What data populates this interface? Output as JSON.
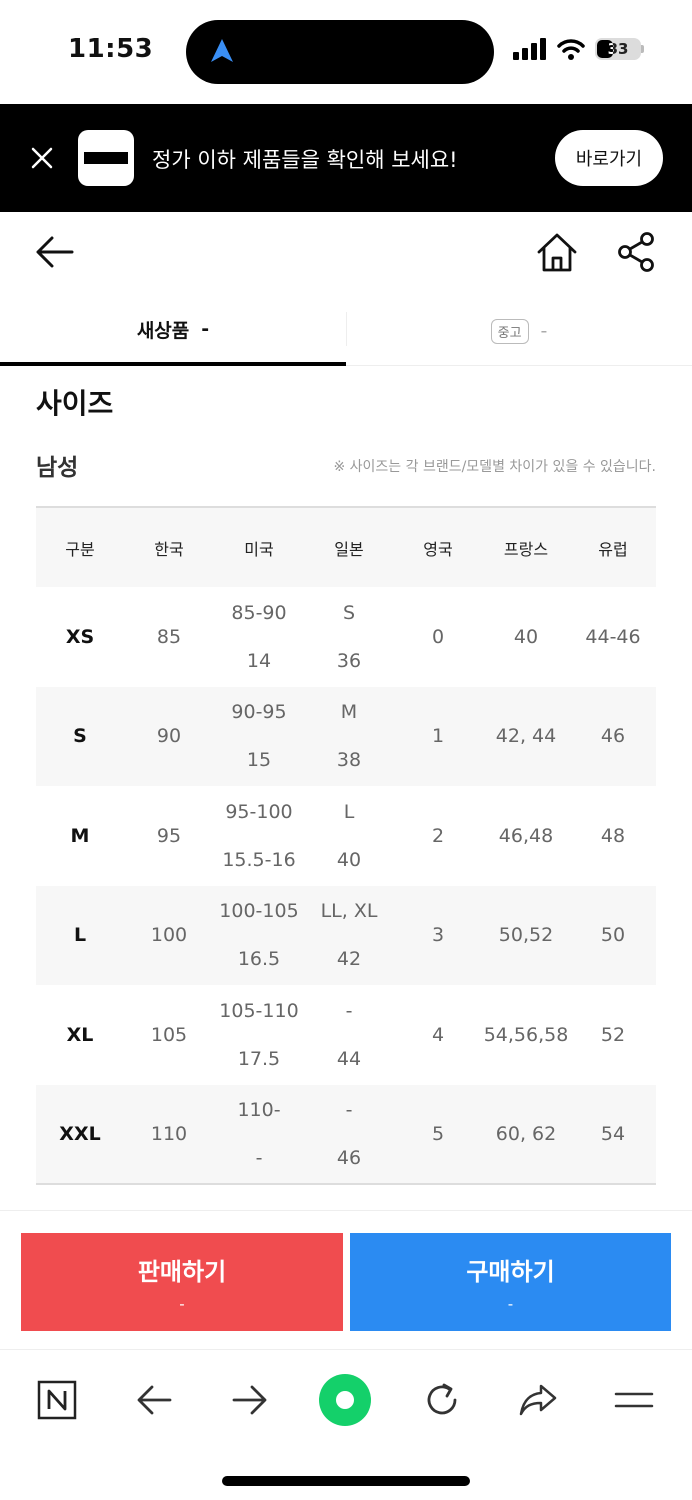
{
  "status_bar": {
    "time": "11:53",
    "battery": "33"
  },
  "banner": {
    "text": "정가 이하 제품들을 확인해 보세요!",
    "button_label": "바로가기"
  },
  "tabs": {
    "new": {
      "label": "새상품",
      "value": "-"
    },
    "used": {
      "badge": "중고",
      "value": "-"
    }
  },
  "section_title": "사이즈",
  "gender": "남성",
  "note": "※ 사이즈는 각 브랜드/모델별 차이가 있을 수 있습니다.",
  "table": {
    "headers": [
      "구분",
      "한국",
      "미국",
      "일본",
      "영국",
      "프랑스",
      "유럽"
    ],
    "rows": [
      {
        "size": "XS",
        "kr": "85",
        "us": [
          "85-90",
          "14"
        ],
        "jp": [
          "S",
          "36"
        ],
        "uk": "0",
        "fr": "40",
        "eu": "44-46"
      },
      {
        "size": "S",
        "kr": "90",
        "us": [
          "90-95",
          "15"
        ],
        "jp": [
          "M",
          "38"
        ],
        "uk": "1",
        "fr": "42, 44",
        "eu": "46"
      },
      {
        "size": "M",
        "kr": "95",
        "us": [
          "95-100",
          "15.5-16"
        ],
        "jp": [
          "L",
          "40"
        ],
        "uk": "2",
        "fr": "46,48",
        "eu": "48"
      },
      {
        "size": "L",
        "kr": "100",
        "us": [
          "100-105",
          "16.5"
        ],
        "jp": [
          "LL, XL",
          "42"
        ],
        "uk": "3",
        "fr": "50,52",
        "eu": "50"
      },
      {
        "size": "XL",
        "kr": "105",
        "us": [
          "105-110",
          "17.5"
        ],
        "jp": [
          "-",
          "44"
        ],
        "uk": "4",
        "fr": "54,56,58",
        "eu": "52"
      },
      {
        "size": "XXL",
        "kr": "110",
        "us": [
          "110-",
          "-"
        ],
        "jp": [
          "-",
          "46"
        ],
        "uk": "5",
        "fr": "60, 62",
        "eu": "54"
      }
    ]
  },
  "actions": {
    "sell": {
      "label": "판매하기",
      "price": "-",
      "color": "#f04c4f"
    },
    "buy": {
      "label": "구매하기",
      "price": "-",
      "color": "#2b8bf2"
    }
  },
  "toolbar_icons": [
    "naver-icon",
    "back-arrow-icon",
    "forward-arrow-icon",
    "green-dot-icon",
    "refresh-icon",
    "share-arrow-icon",
    "menu-icon"
  ]
}
